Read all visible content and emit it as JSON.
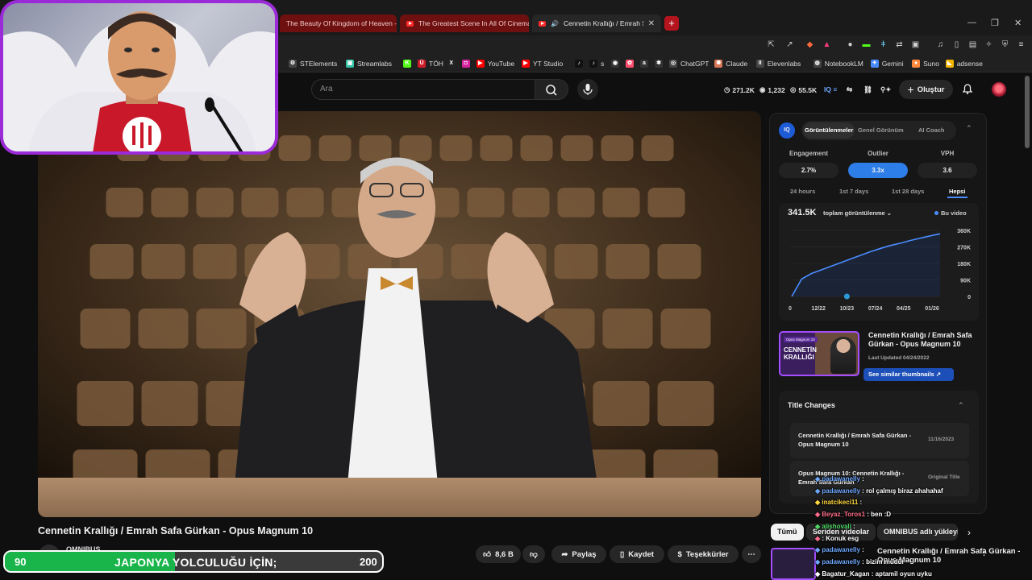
{
  "browser": {
    "tabs": [
      {
        "title": "The Beauty Of Kingdom of Heaven -",
        "active": false
      },
      {
        "title": "The Greatest Scene In All Of Cinema",
        "active": false
      },
      {
        "title": "Cennetin Krallığı / Emrah Safa",
        "active": true
      }
    ],
    "bookmarks": [
      {
        "label": "STElements",
        "icon": "steam-icon",
        "color": "#444444"
      },
      {
        "label": "Streamlabs",
        "icon": "streamlabs-icon",
        "color": "#31c3a2"
      },
      {
        "label": "",
        "icon": "kick-icon",
        "color": "#53fc18"
      },
      {
        "label": "TÖH",
        "icon": "toh-icon",
        "color": "#d01b2a"
      },
      {
        "label": "",
        "icon": "x-icon",
        "color": "#222222"
      },
      {
        "label": "",
        "icon": "instagram-icon",
        "color": "#d6249f"
      },
      {
        "label": "YouTube",
        "icon": "youtube-icon",
        "color": "#ff0000"
      },
      {
        "label": "YT Studio",
        "icon": "yt-studio-icon",
        "color": "#ff0000"
      },
      {
        "label": "",
        "icon": "tiktok-icon",
        "color": "#111111"
      },
      {
        "label": "s",
        "icon": "tiktok-studio-icon",
        "color": "#111111"
      },
      {
        "label": "",
        "icon": "github-icon",
        "color": "#333333"
      },
      {
        "label": "",
        "icon": "discord-icon",
        "color": "#ff4d6d"
      },
      {
        "label": "",
        "icon": "amazon-icon",
        "color": "#333333"
      },
      {
        "label": "",
        "icon": "perplexity-icon",
        "color": "#333333"
      },
      {
        "label": "ChatGPT",
        "icon": "chatgpt-icon",
        "color": "#444444"
      },
      {
        "label": "Claude",
        "icon": "claude-icon",
        "color": "#d97757"
      },
      {
        "label": "Elevenlabs",
        "icon": "elevenlabs-icon",
        "color": "#444444"
      },
      {
        "label": "NotebookLM",
        "icon": "notebooklm-icon",
        "color": "#444444"
      },
      {
        "label": "Gemini",
        "icon": "gemini-icon",
        "color": "#4a8cff"
      },
      {
        "label": "Suno",
        "icon": "suno-icon",
        "color": "#ff8a3d"
      },
      {
        "label": "adsense",
        "icon": "adsense-icon",
        "color": "#f4b400"
      }
    ]
  },
  "header": {
    "search_placeholder": "Ara",
    "stats": {
      "views": "271.2K",
      "videos": "1,232",
      "watch": "55.5K"
    },
    "create_label": "Oluştur"
  },
  "video": {
    "title": "Cennetin Krallığı / Emrah Safa Gürkan - Opus Magnum 10",
    "channel": "OMNIBUS",
    "likes": "8,6 B",
    "share_label": "Paylaş",
    "save_label": "Kaydet",
    "thanks_label": "Teşekkürler"
  },
  "panel": {
    "logo_text": "IQ",
    "tabs": [
      "Görüntülenmeler",
      "Genel Görünüm",
      "AI Coach"
    ],
    "metrics": [
      {
        "label": "Engagement",
        "value": "2.7%"
      },
      {
        "label": "Outlier",
        "value": "3.3x"
      },
      {
        "label": "VPH",
        "value": "3.6"
      }
    ],
    "ranges": [
      "24 hours",
      "1st 7 days",
      "1st 28 days",
      "Hepsi"
    ],
    "total_views": "341.5K",
    "total_label": "toplam görüntülenme",
    "legend_label": "Bu video",
    "thumbnail": {
      "tag": "Opus Magnum 10",
      "text": "CENNETİN KRALLIĞI",
      "title": "Cennetin Krallığı / Emrah Safa Gürkan - Opus Magnum 10",
      "updated": "Last Updated 04/24/2022",
      "similar_label": "See similar thumbnails"
    },
    "title_changes": {
      "heading": "Title Changes",
      "items": [
        {
          "text": "Cennetin Krallığı / Emrah Safa Gürkan - Opus Magnum 10",
          "date": "11/16/2023"
        },
        {
          "text": "Opus Magnum 10: Cennetin Krallığı - Emrah Safa Gürkan",
          "date": "Original Title"
        }
      ]
    }
  },
  "chart_data": {
    "type": "line",
    "x_ticks": [
      "0",
      "12/22",
      "10/23",
      "07/24",
      "04/25",
      "01/26"
    ],
    "y_ticks": [
      "360K",
      "270K",
      "180K",
      "90K",
      "0"
    ],
    "ylim": [
      0,
      360000
    ],
    "series": [
      {
        "name": "Bu video",
        "values": [
          0,
          95000,
          125000,
          145000,
          165000,
          185000,
          205000,
          225000,
          245000,
          262000,
          278000,
          290000,
          305000,
          318000,
          330000,
          341500
        ]
      }
    ],
    "marker_label": "10/23"
  },
  "chips": [
    "Tümü",
    "Seriden videolar",
    "OMNIBUS adlı yükleyiciden"
  ],
  "chat": [
    {
      "user": "padawanelly",
      "text": ":",
      "color": "#6fa8ff"
    },
    {
      "user": "padawanelly",
      "text": ": rol çalmış biraz ahahahaf",
      "color": "#6fa8ff"
    },
    {
      "user": "inatcikeci11",
      "text": ":",
      "color": "#ffd83d"
    },
    {
      "user": "Beyaz_Toros1",
      "text": ": ben :D",
      "color": "#ff6d8a"
    },
    {
      "user": "alishovali",
      "text": ":",
      "color": "#4cd964"
    },
    {
      "user": "",
      "text": ": Konuk esg",
      "color": "#ff6d8a"
    },
    {
      "user": "padawanelly",
      "text": ":",
      "color": "#6fa8ff"
    },
    {
      "user": "padawanelly",
      "text": ": bizim müdür",
      "color": "#6fa8ff"
    },
    {
      "user": "Bagatur_Kagan",
      "text": ": aptamil oyun uyku",
      "color": "#ffffff"
    }
  ],
  "goal": {
    "current": "90",
    "label": "JAPONYA YOLCULUĞU İÇİN;",
    "target": "200",
    "fill_fraction": 0.45
  }
}
